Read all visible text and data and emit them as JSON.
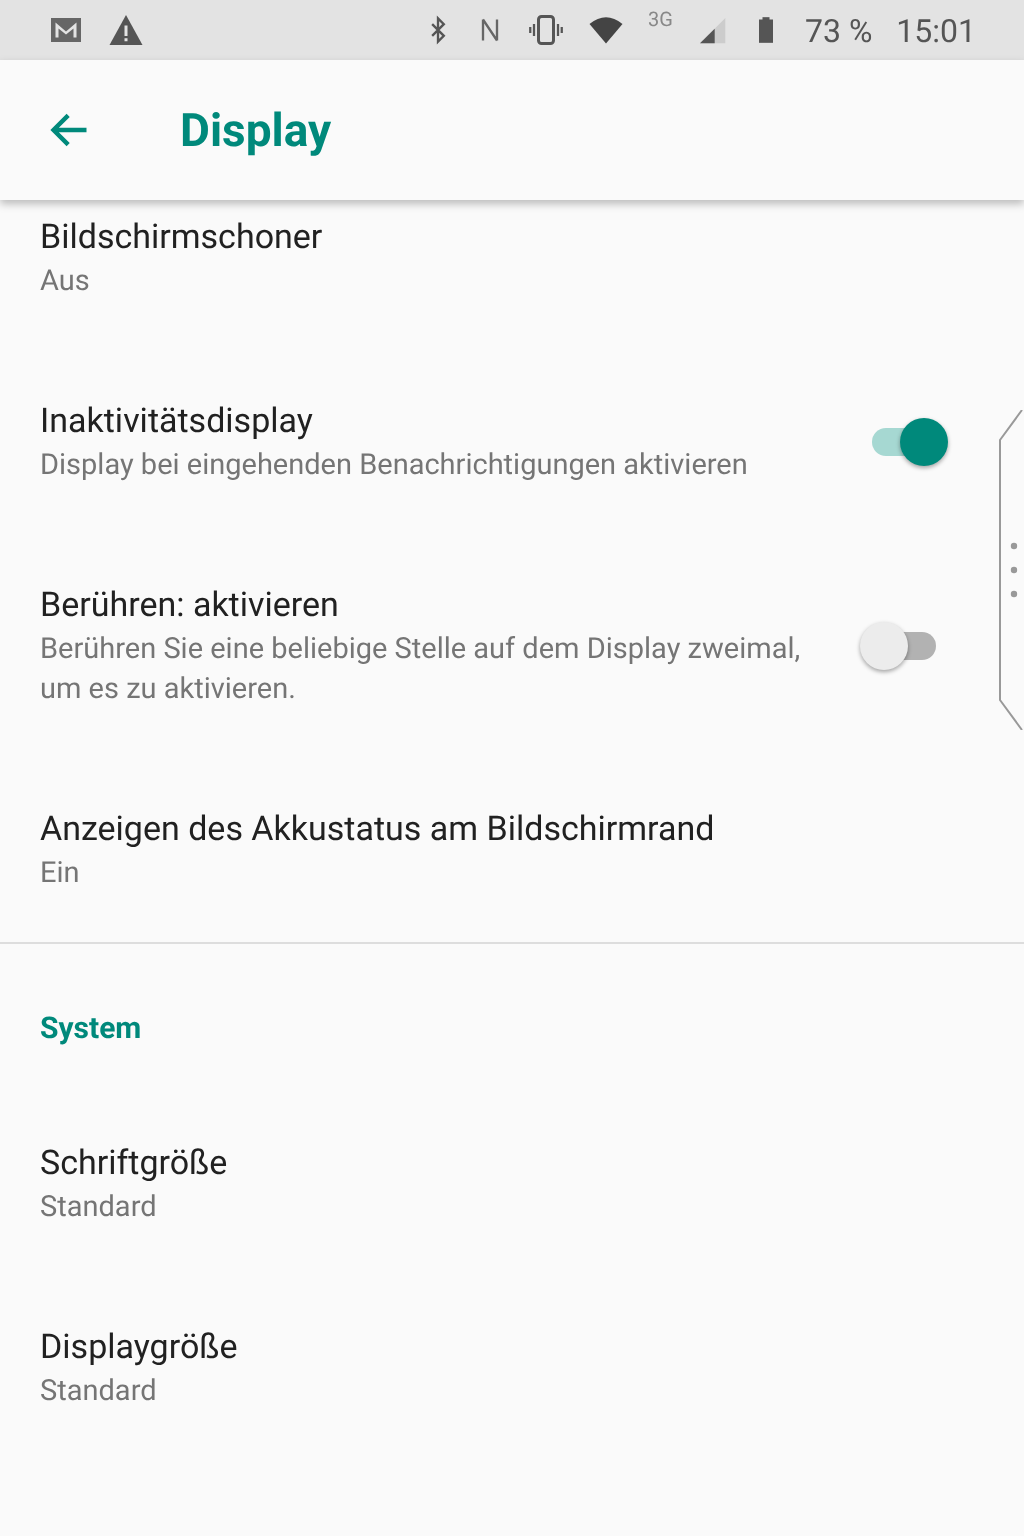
{
  "status_bar": {
    "battery": "73 %",
    "time": "15:01",
    "network": "3G"
  },
  "app_bar": {
    "title": "Display"
  },
  "items": [
    {
      "kind": "plain",
      "title": "Bildschirmschoner",
      "subtitle": "Aus"
    },
    {
      "kind": "switch",
      "title": "Inaktivitätsdisplay",
      "subtitle": "Display bei eingehenden Benachrichtigungen aktivieren",
      "on": true
    },
    {
      "kind": "switch",
      "title": "Berühren: aktivieren",
      "subtitle": "Berühren Sie eine beliebige Stelle auf dem Display zweimal, um es zu aktivieren.",
      "on": false
    },
    {
      "kind": "plain",
      "title": "Anzeigen des Akkustatus am Bildschirmrand",
      "subtitle": "Ein"
    },
    {
      "kind": "divider"
    },
    {
      "kind": "header",
      "title": "System"
    },
    {
      "kind": "plain",
      "title": "Schriftgröße",
      "subtitle": "Standard"
    },
    {
      "kind": "plain",
      "title": "Displaygröße",
      "subtitle": "Standard"
    }
  ]
}
